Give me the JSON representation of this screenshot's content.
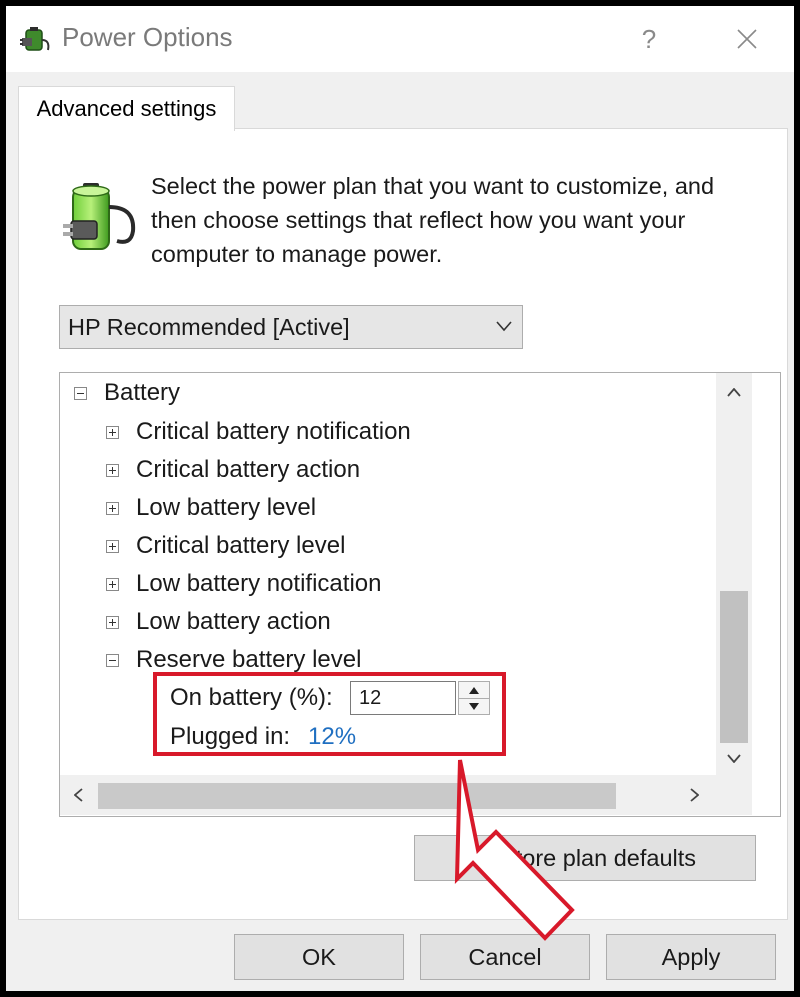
{
  "window": {
    "title": "Power Options",
    "help_glyph": "?",
    "close_glyph": "✕"
  },
  "tab": {
    "label": "Advanced settings"
  },
  "description": "Select the power plan that you want to customize, and then choose settings that reflect how you want your computer to manage power.",
  "plan_select": {
    "value": "HP Recommended [Active]"
  },
  "tree": {
    "group": {
      "label": "Battery",
      "expanded": true
    },
    "items": [
      {
        "label": "Critical battery notification",
        "expanded": false
      },
      {
        "label": "Critical battery action",
        "expanded": false
      },
      {
        "label": "Low battery level",
        "expanded": false
      },
      {
        "label": "Critical battery level",
        "expanded": false
      },
      {
        "label": "Low battery notification",
        "expanded": false
      },
      {
        "label": "Low battery action",
        "expanded": false
      },
      {
        "label": "Reserve battery level",
        "expanded": true
      }
    ],
    "reserve_settings": {
      "on_battery_label": "On battery (%):",
      "on_battery_value": "12",
      "plugged_in_label": "Plugged in:",
      "plugged_in_value": "12%"
    }
  },
  "buttons": {
    "restore": "Restore plan defaults",
    "ok": "OK",
    "cancel": "Cancel",
    "apply": "Apply"
  },
  "colors": {
    "annotation": "#d8192a",
    "link_value": "#1f6fc1"
  },
  "icons": {
    "title": "power-plug-icon",
    "description": "battery-plug-icon"
  }
}
